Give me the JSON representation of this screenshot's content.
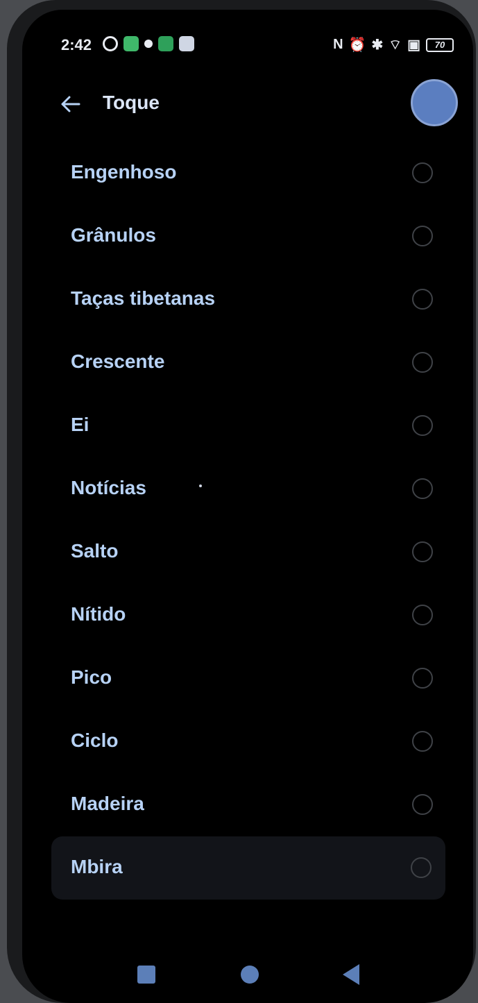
{
  "status_bar": {
    "time": "2:42",
    "battery": "70",
    "left_icons": [
      "settings-icon",
      "app-icon-green",
      "notification-icon",
      "app-icon-green",
      "app-icon-gray"
    ],
    "right_icons": [
      "nfc-icon",
      "alarm-icon",
      "bluetooth-icon",
      "wifi-icon",
      "sim-icon"
    ]
  },
  "header": {
    "title": "Toque"
  },
  "list": {
    "items": [
      {
        "label": "Engenhoso"
      },
      {
        "label": "Grânulos"
      },
      {
        "label": "Taças tibetanas"
      },
      {
        "label": "Crescente"
      },
      {
        "label": "Ei"
      },
      {
        "label": "Notícias"
      },
      {
        "label": "Salto"
      },
      {
        "label": "Nítido"
      },
      {
        "label": "Pico"
      },
      {
        "label": "Ciclo"
      },
      {
        "label": "Madeira"
      },
      {
        "label": "Mbira"
      }
    ]
  },
  "colors": {
    "accent": "#b7d2f5",
    "background": "#000000",
    "nav": "#5c7fb8"
  }
}
